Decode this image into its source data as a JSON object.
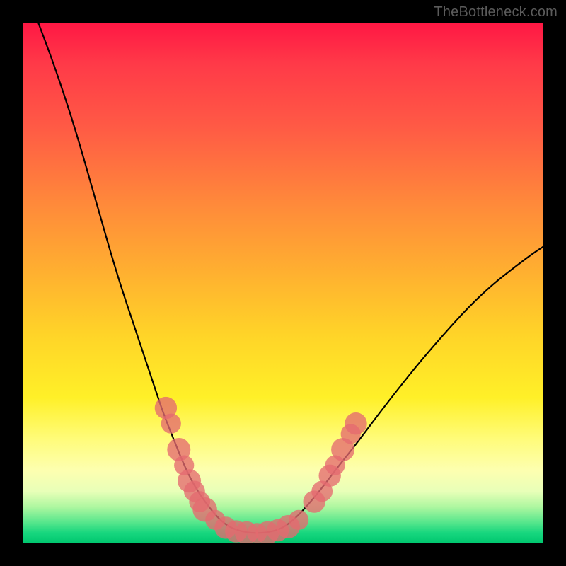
{
  "watermark": "TheBottleneck.com",
  "colors": {
    "frame": "#000000",
    "gradient_top": "#ff1744",
    "gradient_mid": "#fff028",
    "gradient_bottom": "#00c76f",
    "curve": "#000000",
    "bead": "#e46a6f"
  },
  "chart_data": {
    "type": "line",
    "title": "",
    "xlabel": "",
    "ylabel": "",
    "xlim": [
      0,
      100
    ],
    "ylim": [
      0,
      100
    ],
    "grid": false,
    "legend": false,
    "annotations": [],
    "series": [
      {
        "name": "bottleneck-curve",
        "x": [
          3,
          6,
          10,
          14,
          18,
          22,
          25,
          27,
          29,
          31,
          33,
          35,
          37,
          38.5,
          40,
          42,
          44,
          46,
          48,
          50,
          52,
          54,
          57,
          60,
          64,
          70,
          78,
          88,
          97,
          100
        ],
        "y": [
          100,
          92,
          80,
          66,
          52,
          40,
          31,
          25,
          20,
          15,
          11,
          8,
          5.5,
          4,
          3,
          2.3,
          2,
          2,
          2.3,
          3,
          4.5,
          6.5,
          10,
          14,
          19,
          27,
          37,
          48,
          55,
          57
        ],
        "note": "y is bottleneck percent; minimum (green zone) around x≈44–48"
      }
    ],
    "beads": {
      "name": "sample-points",
      "note": "pink markers overlaid on the curve near the trough",
      "points": [
        {
          "x": 27.5,
          "y": 26,
          "r": 1.2
        },
        {
          "x": 28.5,
          "y": 23,
          "r": 1.0
        },
        {
          "x": 30,
          "y": 18,
          "r": 1.3
        },
        {
          "x": 31,
          "y": 15,
          "r": 1.0
        },
        {
          "x": 32,
          "y": 12,
          "r": 1.3
        },
        {
          "x": 33,
          "y": 10,
          "r": 1.1
        },
        {
          "x": 34,
          "y": 8,
          "r": 1.1
        },
        {
          "x": 35,
          "y": 6.5,
          "r": 1.4
        },
        {
          "x": 37,
          "y": 4.5,
          "r": 1.0
        },
        {
          "x": 39,
          "y": 3,
          "r": 1.2
        },
        {
          "x": 41,
          "y": 2.3,
          "r": 1.2
        },
        {
          "x": 43,
          "y": 2,
          "r": 1.3
        },
        {
          "x": 45,
          "y": 2,
          "r": 1.0
        },
        {
          "x": 47,
          "y": 2,
          "r": 1.3
        },
        {
          "x": 49,
          "y": 2.5,
          "r": 1.2
        },
        {
          "x": 51,
          "y": 3.2,
          "r": 1.3
        },
        {
          "x": 53,
          "y": 4.5,
          "r": 1.0
        },
        {
          "x": 56,
          "y": 8,
          "r": 1.2
        },
        {
          "x": 57.5,
          "y": 10,
          "r": 1.1
        },
        {
          "x": 59,
          "y": 13,
          "r": 1.2
        },
        {
          "x": 60,
          "y": 15,
          "r": 1.0
        },
        {
          "x": 61.5,
          "y": 18,
          "r": 1.3
        },
        {
          "x": 63,
          "y": 21,
          "r": 1.0
        },
        {
          "x": 64,
          "y": 23,
          "r": 1.2
        }
      ]
    }
  }
}
